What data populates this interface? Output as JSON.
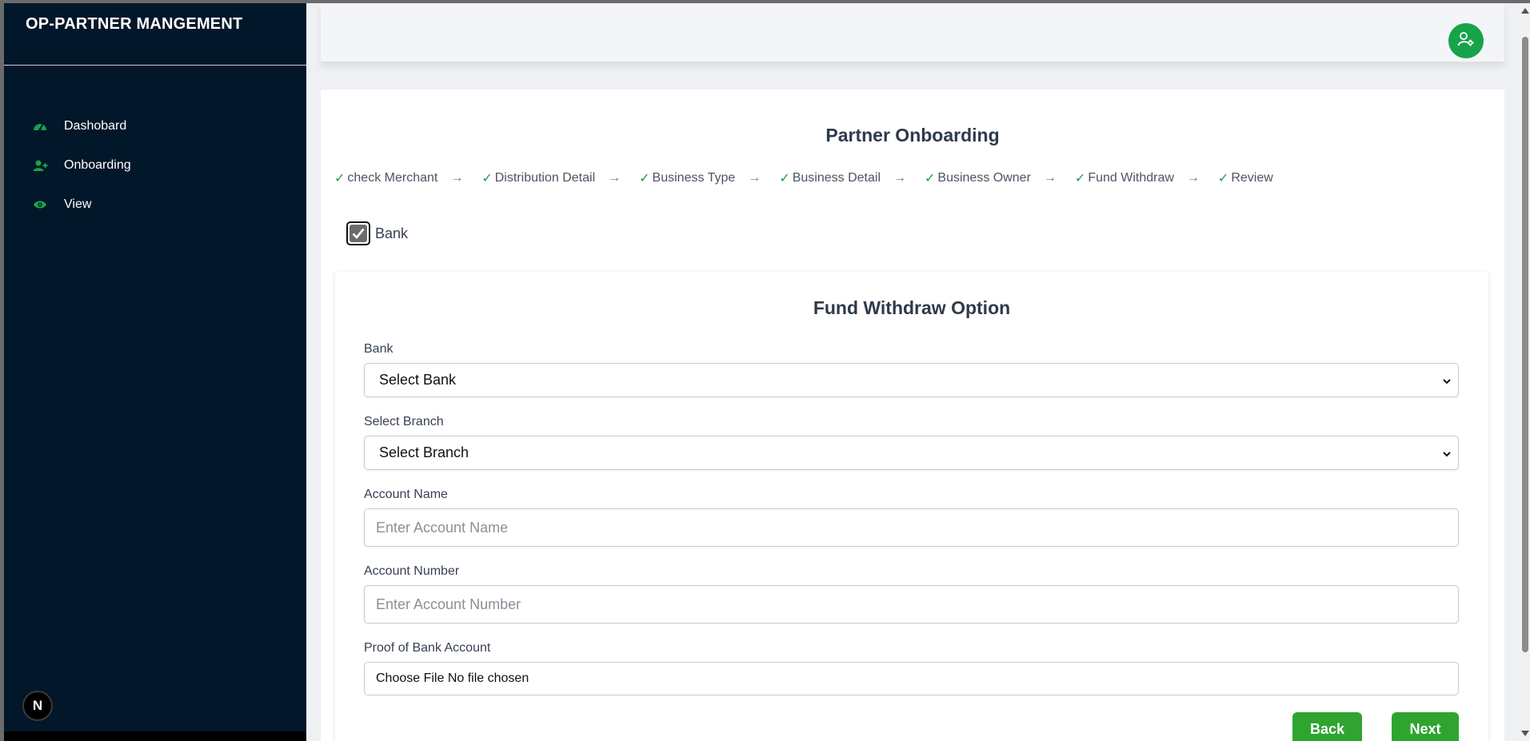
{
  "app": {
    "title": "OP-PARTNER MANGEMENT"
  },
  "sidebar": {
    "items": [
      {
        "label": "Dashobard",
        "icon": "gauge-icon"
      },
      {
        "label": "Onboarding",
        "icon": "user-plus-icon"
      },
      {
        "label": "View",
        "icon": "eye-icon"
      }
    ],
    "badge": "N"
  },
  "header": {
    "user_icon": "user-settings-icon",
    "accent": "#16a34a"
  },
  "page": {
    "title": "Partner Onboarding",
    "steps": [
      "check Merchant",
      "Distribution Detail",
      "Business Type",
      "Business Detail",
      "Business Owner",
      "Fund Withdraw",
      "Review"
    ],
    "step_check": "✓",
    "step_arrow": "→",
    "bank_toggle": {
      "label": "Bank",
      "checked": true
    }
  },
  "form": {
    "title": "Fund Withdraw Option",
    "bank_label": "Bank",
    "bank_value": "Select Bank",
    "branch_label": "Select Branch",
    "branch_value": "Select Branch",
    "account_name_label": "Account Name",
    "account_name_placeholder": "Enter Account Name",
    "account_number_label": "Account Number",
    "account_number_placeholder": "Enter Account Number",
    "proof_label": "Proof of Bank Account",
    "proof_value": "Choose File No file chosen",
    "back_label": "Back",
    "next_label": "Next",
    "button_color": "#2fa52f"
  }
}
